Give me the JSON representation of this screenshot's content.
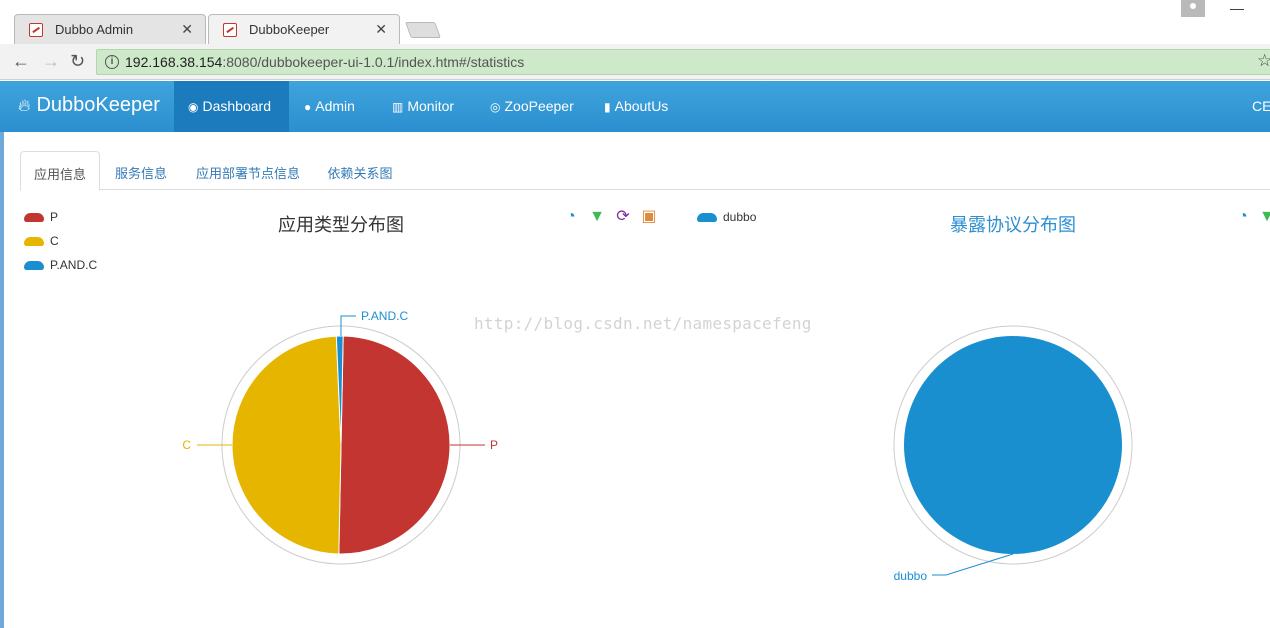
{
  "browser": {
    "tabs": [
      {
        "title": "Dubbo Admin",
        "active": false
      },
      {
        "title": "DubboKeeper",
        "active": true
      }
    ],
    "url_host": "192.168.38.154",
    "url_rest": ":8080/dubbokeeper-ui-1.0.1/index.htm#/statistics"
  },
  "navbar": {
    "brand": "DubboKeeper",
    "items": [
      {
        "label": "Dashboard",
        "icon": "dashboard-icon",
        "active": true
      },
      {
        "label": "Admin",
        "icon": "user-icon",
        "active": false
      },
      {
        "label": "Monitor",
        "icon": "chart-icon",
        "active": false
      },
      {
        "label": "ZooPeeper",
        "icon": "eye-icon",
        "active": false
      },
      {
        "label": "AboutUs",
        "icon": "bookmark-icon",
        "active": false
      }
    ],
    "right_text": "CE"
  },
  "content_tabs": [
    {
      "label": "应用信息",
      "active": true
    },
    {
      "label": "服务信息",
      "active": false
    },
    {
      "label": "应用部署节点信息",
      "active": false
    },
    {
      "label": "依赖关系图",
      "active": false
    }
  ],
  "watermark": "http://blog.csdn.net/namespacefeng",
  "colors": {
    "p": "#c23531",
    "c": "#e5b500",
    "pandc": "#1a8fd0",
    "accent": "#2b8fd0"
  },
  "chart_data": [
    {
      "type": "pie",
      "title": "应用类型分布图",
      "legend": [
        "P",
        "C",
        "P.AND.C"
      ],
      "categories": [
        "P",
        "C",
        "P.AND.C"
      ],
      "values": [
        50,
        49,
        1
      ],
      "legend_position": "top-left",
      "toolbox": [
        "pie-icon",
        "funnel-icon",
        "refresh-icon",
        "save-icon"
      ]
    },
    {
      "type": "pie",
      "title": "暴露协议分布图",
      "legend": [
        "dubbo"
      ],
      "categories": [
        "dubbo"
      ],
      "values": [
        100
      ],
      "legend_position": "top-left",
      "toolbox": [
        "pie-icon",
        "funnel-icon"
      ]
    }
  ]
}
